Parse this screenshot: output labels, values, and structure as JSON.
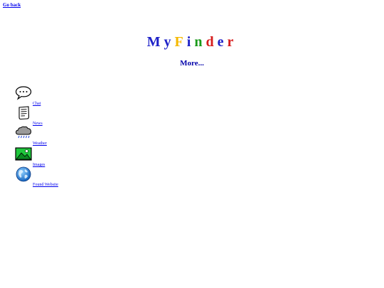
{
  "nav": {
    "go_back": "Go back"
  },
  "logo": {
    "letters": [
      {
        "char": "M",
        "color": "#1e22c8"
      },
      {
        "char": "y",
        "color": "#1e22c8"
      },
      {
        "char": "F",
        "color": "#f5b800"
      },
      {
        "char": "i",
        "color": "#1e22c8"
      },
      {
        "char": "n",
        "color": "#1a9a1a"
      },
      {
        "char": "d",
        "color": "#d61e1e"
      },
      {
        "char": "e",
        "color": "#1e22c8"
      },
      {
        "char": "r",
        "color": "#d61e1e"
      }
    ]
  },
  "more": {
    "label": "More..."
  },
  "menu": {
    "items": [
      {
        "label": "Chat",
        "icon": "chat-bubble-icon"
      },
      {
        "label": "News",
        "icon": "news-icon"
      },
      {
        "label": "Weather",
        "icon": "rain-cloud-icon"
      },
      {
        "label": "Images",
        "icon": "image-icon"
      },
      {
        "label": "Found Website",
        "icon": "globe-icon"
      }
    ]
  }
}
